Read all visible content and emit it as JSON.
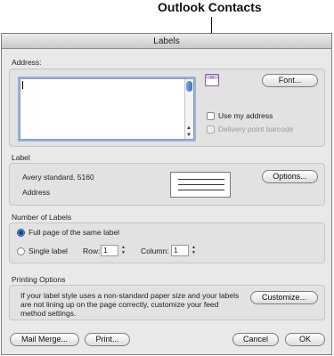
{
  "callout": {
    "text": "Outlook Contacts"
  },
  "window": {
    "title": "Labels"
  },
  "address": {
    "group_label": "Address:",
    "value": "",
    "font_button": "Font...",
    "use_my_address": "Use my address",
    "delivery_barcode": "Delivery point barcode",
    "contacts_icon": "address-book-icon"
  },
  "label": {
    "group_label": "Label",
    "name": "Avery standard, 5160",
    "type": "Address",
    "options_button": "Options..."
  },
  "number_of_labels": {
    "group_label": "Number of Labels",
    "full_page": "Full page of the same label",
    "single_label": "Single label",
    "row_label": "Row:",
    "row_value": "1",
    "column_label": "Column:",
    "column_value": "1"
  },
  "printing_options": {
    "group_label": "Printing Options",
    "description": "If your label style uses a non-standard paper size and your labels are not lining up on the page correctly, customize your feed method settings.",
    "customize_button": "Customize..."
  },
  "footer": {
    "mail_merge": "Mail Merge...",
    "print": "Print...",
    "cancel": "Cancel",
    "ok": "OK"
  },
  "colors": {
    "accent": "#3d73c4",
    "focus_ring": "#8fb4e6"
  }
}
